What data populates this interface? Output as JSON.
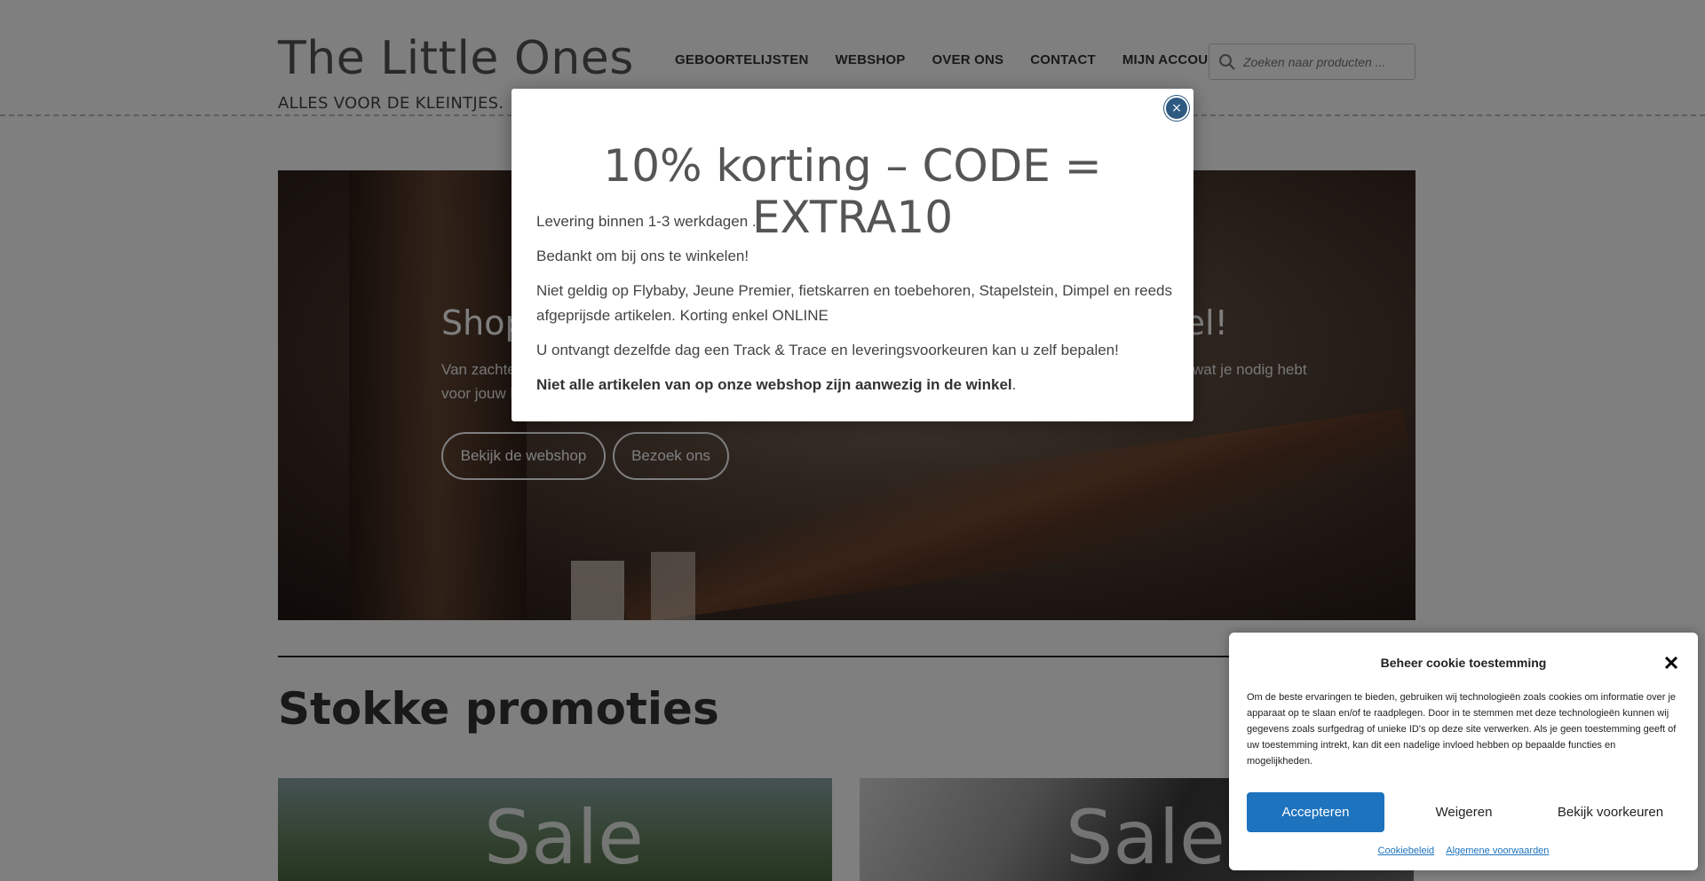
{
  "site": {
    "title": "The Little Ones",
    "tagline": "ALLES VOOR DE KLEINTJES."
  },
  "nav": {
    "items": [
      {
        "label": "GEBOORTELIJSTEN"
      },
      {
        "label": "WEBSHOP"
      },
      {
        "label": "OVER ONS"
      },
      {
        "label": "CONTACT"
      },
      {
        "label": "MIJN ACCOUNT"
      }
    ]
  },
  "search": {
    "placeholder": "Zoeken naar producten ..."
  },
  "hero": {
    "title_start": "Shop",
    "title_end": "kel!",
    "text_start": "Van zachte",
    "text_line2_start": "voor jouw l",
    "text_end": "wat je nodig hebt",
    "buttons": {
      "webshop": "Bekijk de webshop",
      "visit": "Bezoek ons"
    }
  },
  "section": {
    "title": "Stokke promoties"
  },
  "promos": [
    {
      "label": "Sale"
    },
    {
      "label": "Sale"
    }
  ],
  "modal": {
    "close": "×",
    "heading": "10% korting – CODE = EXTRA10",
    "lines": [
      "Levering binnen 1-3 werkdagen .",
      "Bedankt om bij ons te winkelen!",
      "Niet geldig op Flybaby, Jeune Premier, fietskarren en toebehoren, Stapelstein, Dimpel en reeds afgeprijsde artikelen. Korting enkel ONLINE",
      "U ontvangt dezelfde dag een Track & Trace en leveringsvoorkeuren kan u zelf bepalen!"
    ],
    "bold_line": "Niet alle artikelen van op onze webshop zijn aanwezig in de winkel",
    "bold_suffix": "."
  },
  "cookie": {
    "title": "Beheer cookie toestemming",
    "text": "Om de beste ervaringen te bieden, gebruiken wij technologieën zoals cookies om informatie over je apparaat op te slaan en/of te raadplegen. Door in te stemmen met deze technologieën kunnen wij gegevens zoals surfgedrag of unieke ID's op deze site verwerken. Als je geen toestemming geeft of uw toestemming intrekt, kan dit een nadelige invloed hebben op bepaalde functies en mogelijkheden.",
    "accept": "Accepteren",
    "deny": "Weigeren",
    "prefs": "Bekijk voorkeuren",
    "links": {
      "policy": "Cookiebeleid",
      "terms": "Algemene voorwaarden"
    }
  },
  "colors": {
    "accent_blue": "#1e73be",
    "modal_close": "#2e5a82"
  }
}
